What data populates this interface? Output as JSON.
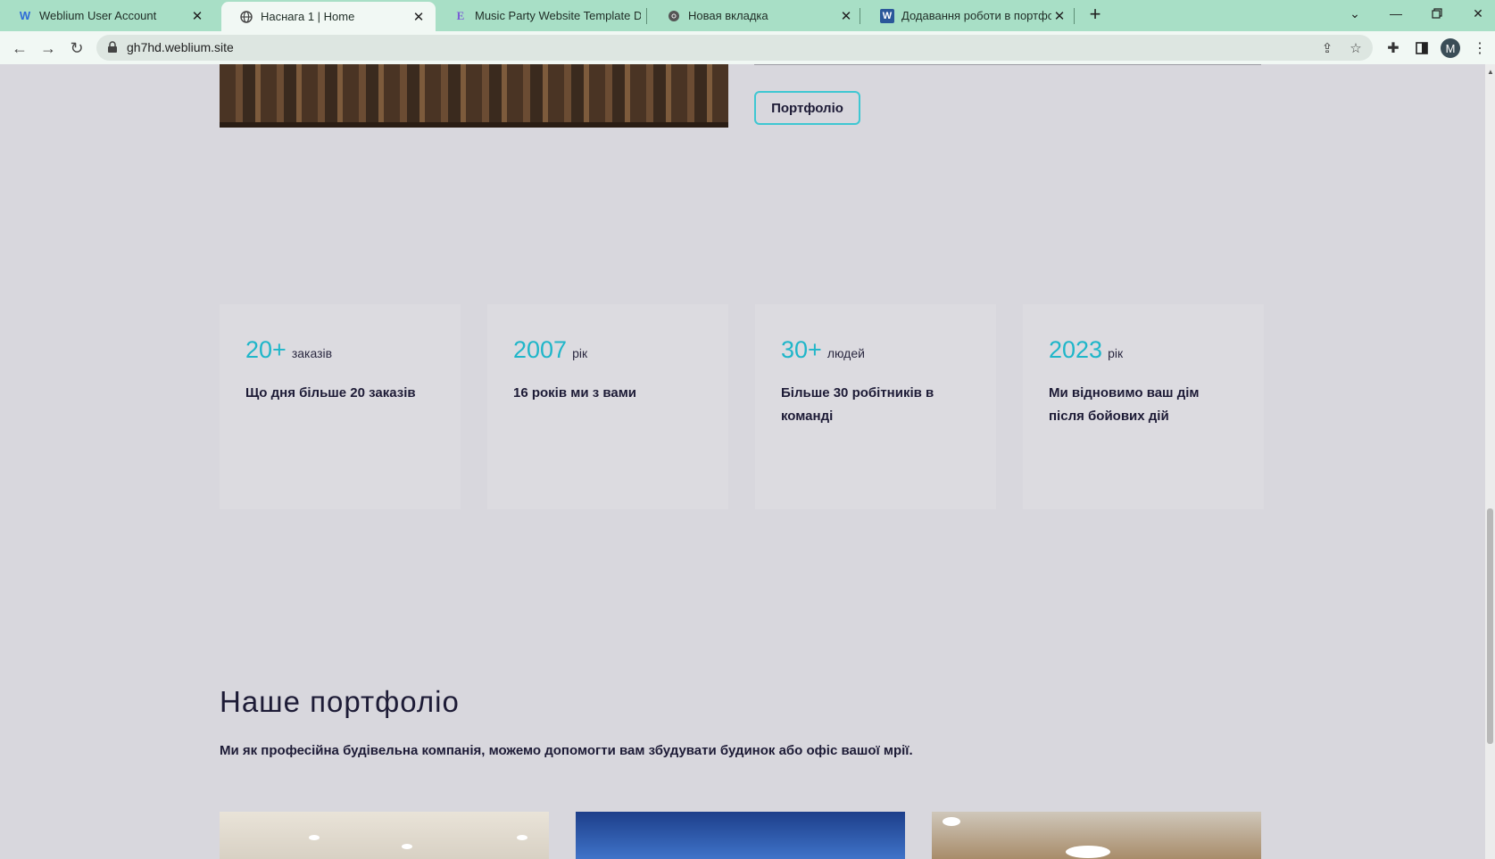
{
  "browser": {
    "tabs": [
      {
        "title": "Weblium User Account",
        "icon": "weblium-icon",
        "active": false
      },
      {
        "title": "Наснага 1 | Home",
        "icon": "globe-icon",
        "active": true
      },
      {
        "title": "Music Party Website Template De",
        "icon": "envato-icon",
        "active": false
      },
      {
        "title": "Новая вкладка",
        "icon": "chrome-icon",
        "active": false
      },
      {
        "title": "Додавання роботи в портфоліо",
        "icon": "word-icon",
        "active": false
      }
    ],
    "url": "gh7hd.weblium.site",
    "profile_initial": "M"
  },
  "page": {
    "portfolio_button": "Портфоліо",
    "stats": [
      {
        "number": "20+",
        "unit": "заказів",
        "description": "Що дня більше 20 заказів"
      },
      {
        "number": "2007",
        "unit": "рік",
        "description": "16 років ми з вами"
      },
      {
        "number": "30+",
        "unit": "людей",
        "description": "Більше 30 робітників в команді"
      },
      {
        "number": "2023",
        "unit": "рік",
        "description": "Ми відновимо ваш дім після бойових дій"
      }
    ],
    "portfolio": {
      "title": "Наше портфоліо",
      "subtitle": "Ми як професійна будівельна компанія, можемо допомогти вам збудувати будинок або офіс вашої мрії."
    }
  },
  "colors": {
    "accent": "#1fb6c9",
    "text_dark": "#1d1b36",
    "page_bg": "#d8d7dd",
    "tab_bar": "#a8dfc6"
  }
}
